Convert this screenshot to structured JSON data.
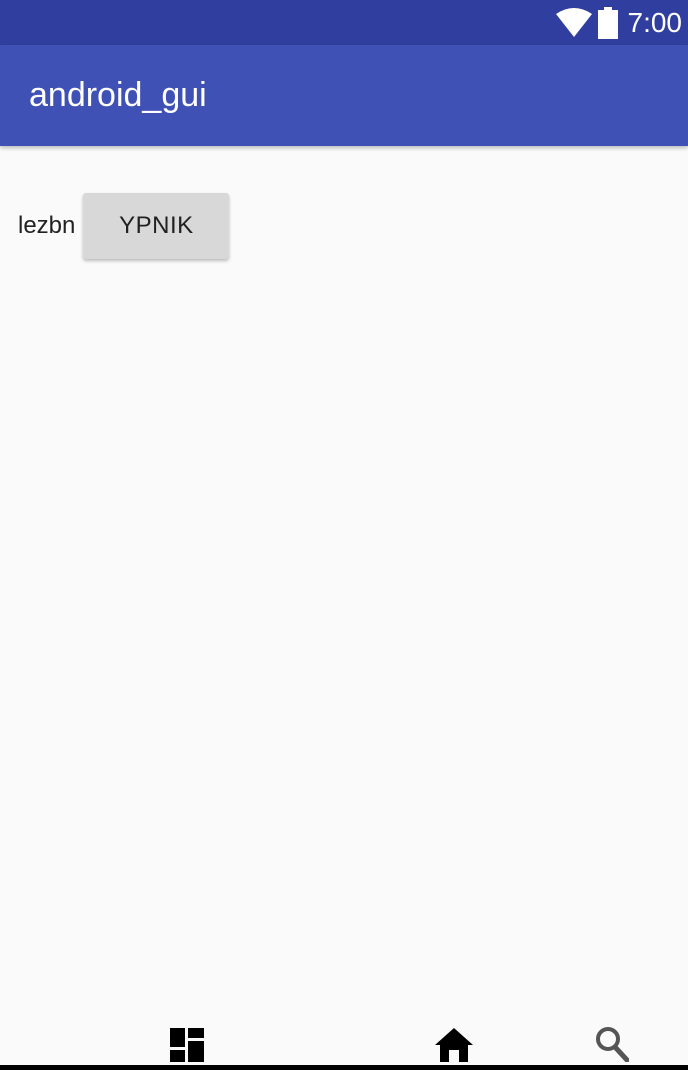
{
  "status_bar": {
    "time": "7:00",
    "wifi_icon": "wifi-icon",
    "battery_icon": "battery-icon",
    "background": "#303f9f"
  },
  "app_bar": {
    "title": "android_gui",
    "background": "#3f51b5"
  },
  "main": {
    "label": "lezbn",
    "button_label": "YPNIK"
  },
  "nav_bar": {
    "items": [
      {
        "icon": "dashboard-icon"
      },
      {
        "icon": "home-icon"
      },
      {
        "icon": "search-icon"
      }
    ]
  }
}
